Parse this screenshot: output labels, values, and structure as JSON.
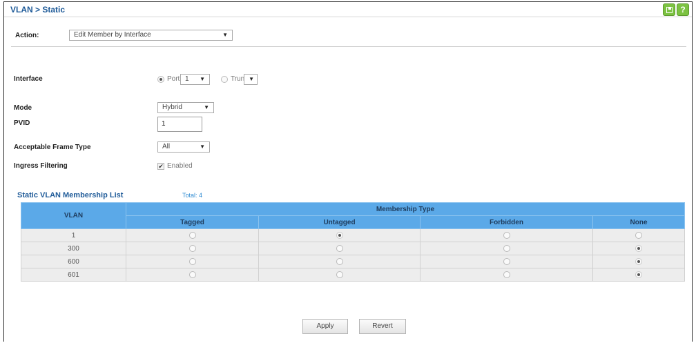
{
  "page": {
    "title": "VLAN > Static"
  },
  "action": {
    "label": "Action:",
    "value": "Edit Member by Interface"
  },
  "form": {
    "interface_label": "Interface",
    "port_label": "Port",
    "port_value": "1",
    "trunk_label": "Trunk",
    "trunk_value": "",
    "mode_label": "Mode",
    "mode_value": "Hybrid",
    "pvid_label": "PVID",
    "pvid_value": "1",
    "frame_type_label": "Acceptable Frame Type",
    "frame_type_value": "All",
    "ingress_label": "Ingress Filtering",
    "ingress_option": "Enabled"
  },
  "list": {
    "title": "Static VLAN Membership List",
    "total": "Total: 4",
    "headers": {
      "vlan": "VLAN",
      "membership": "Membership Type",
      "tagged": "Tagged",
      "untagged": "Untagged",
      "forbidden": "Forbidden",
      "none": "None"
    },
    "rows": [
      {
        "vlan": "1",
        "selected": "untagged"
      },
      {
        "vlan": "300",
        "selected": "none"
      },
      {
        "vlan": "600",
        "selected": "none"
      },
      {
        "vlan": "601",
        "selected": "none"
      }
    ]
  },
  "buttons": {
    "apply": "Apply",
    "revert": "Revert"
  },
  "colors": {
    "title": "#1e5a98",
    "header_bg": "#5ba9e8",
    "row_bg": "#ededed",
    "icon_green": "#7cc242"
  },
  "icons": {
    "save": "save-icon",
    "help": "help-icon"
  }
}
